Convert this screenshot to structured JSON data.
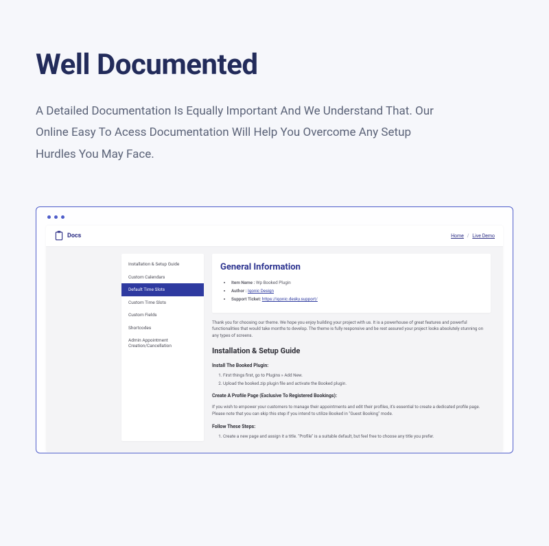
{
  "hero": {
    "title": "Well Documented",
    "subtitle": "A Detailed Documentation Is Equally Important And We Understand That. Our Online Easy To Acess Documentation Will Help You Overcome Any Setup Hurdles You May Face."
  },
  "docs": {
    "brand": "Docs",
    "top_links": {
      "home": "Home",
      "live_demo": "Live Demo",
      "sep": "/"
    },
    "sidebar": {
      "items": [
        {
          "label": "Installation & Setup Guide",
          "active": false
        },
        {
          "label": "Custom Calendars",
          "active": false
        },
        {
          "label": "Default Time Slots",
          "active": true
        },
        {
          "label": "Custom Time Slots",
          "active": false
        },
        {
          "label": "Custom Fields",
          "active": false
        },
        {
          "label": "Shortcodes",
          "active": false
        },
        {
          "label": "Admin Appointment Creation/Cancellation",
          "active": false
        }
      ]
    },
    "general": {
      "heading": "General Information",
      "meta": {
        "item_name_label": "Item Name :",
        "item_name_value": "Wp Booked Plugin",
        "author_label": "Author :",
        "author_value": "Iqonic Design",
        "support_label": "Support Ticket:",
        "support_value": "https://iqonic.desky.support/"
      }
    },
    "intro_para": "Thank you for choosing our theme. We hope you enjoy building your project with us. It is a powerhouse of great features and powerful functionalities that would take months to develop. The theme is fully responsive and be rest assured your project looks absolutely stunning on any types of screens.",
    "install": {
      "heading": "Installation & Setup Guide",
      "sub1": "Install The Booked Plugin:",
      "steps1": [
        "First things first, go to Plugins » Add New.",
        "Upload the booked.zip plugin file and activate the Booked plugin."
      ],
      "sub2": "Create A Profile Page (Exclusive To Registered Bookings):",
      "para2": "If you wish to empower your customers to manage their appointments and edit their profiles, it's essential to create a dedicated profile page. Please note that you can skip this step if you intend to utilize Booked in \"Guest Booking\" mode.",
      "sub3": "Follow These Steps:",
      "steps3": [
        "Create a new page and assign it a title. \"Profile\" is a suitable default, but feel free to choose any title you prefer."
      ]
    }
  }
}
